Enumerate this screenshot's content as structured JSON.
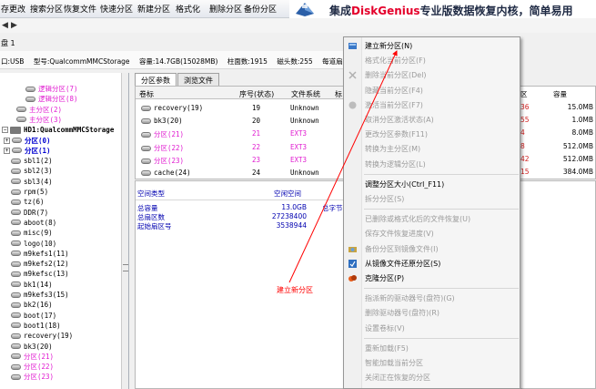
{
  "toolbar": {
    "buttons": [
      "存更改",
      "搜索分区",
      "恢复文件",
      "快速分区",
      "新建分区",
      "格式化",
      "删除分区",
      "备份分区"
    ],
    "brand_prefix": "集成",
    "brand_name": "DiskGenius",
    "brand_suffix": "专业版数据恢复内核，简单易用",
    "brand_color": "#e4002b"
  },
  "nav": {
    "back_icon": "arrow-left-icon",
    "forward_icon": "arrow-right-icon"
  },
  "disk_label": "盘 1",
  "info": {
    "interface": "口:USB",
    "model": "型号:QualcommMMCStorage",
    "capacity": "容量:14.7GB(15028MB)",
    "cylinders": "柱面数:1915",
    "heads": "磁头数:255",
    "sectors": "每道扇"
  },
  "tree": {
    "items": [
      {
        "label": "逻辑分区(7)",
        "style": "pink"
      },
      {
        "label": "逻辑分区(8)",
        "style": "pink"
      },
      {
        "label": "主分区(2)",
        "style": "pink"
      },
      {
        "label": "主分区(3)",
        "style": "pink"
      },
      {
        "label": "HD1:QualcommMMCStorage",
        "style": "bold"
      },
      {
        "label": "分区(0)",
        "style": "blue"
      },
      {
        "label": "分区(1)",
        "style": "blue"
      },
      {
        "label": "sbl1(2)",
        "style": ""
      },
      {
        "label": "sbl2(3)",
        "style": ""
      },
      {
        "label": "sbl3(4)",
        "style": ""
      },
      {
        "label": "rpm(5)",
        "style": ""
      },
      {
        "label": "tz(6)",
        "style": ""
      },
      {
        "label": "DDR(7)",
        "style": ""
      },
      {
        "label": "aboot(8)",
        "style": ""
      },
      {
        "label": "misc(9)",
        "style": ""
      },
      {
        "label": "logo(10)",
        "style": ""
      },
      {
        "label": "m9kefs1(11)",
        "style": ""
      },
      {
        "label": "m9kefs2(12)",
        "style": ""
      },
      {
        "label": "m9kefsc(13)",
        "style": ""
      },
      {
        "label": "bk1(14)",
        "style": ""
      },
      {
        "label": "m9kefs3(15)",
        "style": ""
      },
      {
        "label": "bk2(16)",
        "style": ""
      },
      {
        "label": "boot(17)",
        "style": ""
      },
      {
        "label": "boot1(18)",
        "style": ""
      },
      {
        "label": "recovery(19)",
        "style": ""
      },
      {
        "label": "bk3(20)",
        "style": ""
      },
      {
        "label": "分区(21)",
        "style": "pink"
      },
      {
        "label": "分区(22)",
        "style": "pink"
      },
      {
        "label": "分区(23)",
        "style": "pink"
      }
    ]
  },
  "tabs": [
    "分区参数",
    "浏览文件"
  ],
  "table": {
    "headers": [
      "卷标",
      "序号(状态)",
      "文件系统",
      "标"
    ],
    "rows": [
      {
        "name": "recovery(19)",
        "index": "19",
        "fs": "Unknown",
        "style": ""
      },
      {
        "name": "bk3(20)",
        "index": "20",
        "fs": "Unknown",
        "style": ""
      },
      {
        "name": "分区(21)",
        "index": "21",
        "fs": "EXT3",
        "style": "pink"
      },
      {
        "name": "分区(22)",
        "index": "22",
        "fs": "EXT3",
        "style": "pink"
      },
      {
        "name": "分区(23)",
        "index": "23",
        "fs": "EXT3",
        "style": "pink"
      },
      {
        "name": "cache(24)",
        "index": "24",
        "fs": "Unknown",
        "style": ""
      }
    ]
  },
  "right_cols": {
    "headers": [
      "区",
      "容量"
    ],
    "rows": [
      {
        "a": "36",
        "b": "15.0MB"
      },
      {
        "a": "55",
        "b": "1.0MB"
      },
      {
        "a": "4",
        "b": "8.0MB"
      },
      {
        "a": "8",
        "b": "512.0MB"
      },
      {
        "a": "42",
        "b": "512.0MB"
      },
      {
        "a": "15",
        "b": "384.0MB"
      }
    ]
  },
  "detail": {
    "type_label": "空间类型",
    "free_label": "空闲空间",
    "total_label": "总容量",
    "total_value": "13.0GB",
    "sectors_label": "总扇区数",
    "sectors_value": "27238400",
    "start_label": "起始扇区号",
    "start_value": "3538944",
    "bytes_label": "总字节"
  },
  "menu": {
    "items": [
      {
        "label": "建立新分区(N)",
        "enabled": true,
        "icon": "new-partition-icon",
        "sep_after": false
      },
      {
        "label": "格式化当前分区(F)",
        "enabled": false,
        "icon": "",
        "sep_after": false
      },
      {
        "label": "删除当前分区(Del)",
        "enabled": false,
        "icon": "delete-icon",
        "sep_after": false
      },
      {
        "label": "隐藏当前分区(F4)",
        "enabled": false,
        "icon": "",
        "sep_after": false
      },
      {
        "label": "激活当前分区(F7)",
        "enabled": false,
        "icon": "activate-icon",
        "sep_after": false
      },
      {
        "label": "取消分区激活状态(A)",
        "enabled": false,
        "icon": "",
        "sep_after": false
      },
      {
        "label": "更改分区参数(F11)",
        "enabled": false,
        "icon": "",
        "sep_after": false
      },
      {
        "label": "转换为主分区(M)",
        "enabled": false,
        "icon": "",
        "sep_after": false
      },
      {
        "label": "转换为逻辑分区(L)",
        "enabled": false,
        "icon": "",
        "sep_after": true
      },
      {
        "label": "调整分区大小(Ctrl_F11)",
        "enabled": true,
        "icon": "",
        "sep_after": false
      },
      {
        "label": "拆分分区(S)",
        "enabled": false,
        "icon": "",
        "sep_after": true
      },
      {
        "label": "已删除或格式化后的文件恢复(U)",
        "enabled": false,
        "icon": "",
        "sep_after": false
      },
      {
        "label": "保存文件恢复进度(V)",
        "enabled": false,
        "icon": "",
        "sep_after": false
      },
      {
        "label": "备份分区到镜像文件(I)",
        "enabled": false,
        "icon": "backup-icon",
        "sep_after": false
      },
      {
        "label": "从镜像文件还原分区(S)",
        "enabled": true,
        "icon": "restore-icon",
        "sep_after": false
      },
      {
        "label": "克隆分区(P)",
        "enabled": true,
        "icon": "clone-icon",
        "sep_after": true
      },
      {
        "label": "指派新的驱动器号(盘符)(G)",
        "enabled": false,
        "icon": "",
        "sep_after": false
      },
      {
        "label": "删除驱动器号(盘符)(R)",
        "enabled": false,
        "icon": "",
        "sep_after": false
      },
      {
        "label": "设置卷标(V)",
        "enabled": false,
        "icon": "",
        "sep_after": true
      },
      {
        "label": "重新加载(F5)",
        "enabled": false,
        "icon": "",
        "sep_after": false
      },
      {
        "label": "智能加载当前分区",
        "enabled": false,
        "icon": "",
        "sep_after": false
      },
      {
        "label": "关闭正在恢复的分区",
        "enabled": false,
        "icon": "",
        "sep_after": false
      }
    ]
  },
  "annotation": {
    "text": "建立新分区",
    "color": "#ff0000"
  }
}
